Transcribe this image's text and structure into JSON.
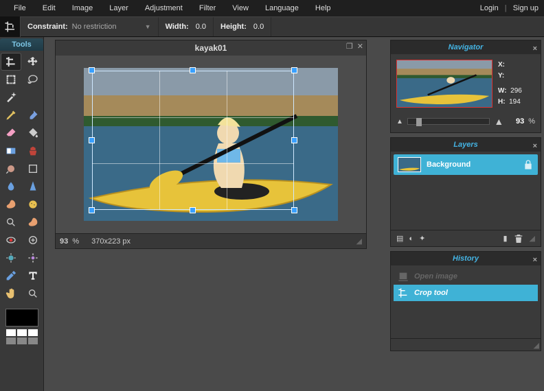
{
  "menu": {
    "items": [
      "File",
      "Edit",
      "Image",
      "Layer",
      "Adjustment",
      "Filter",
      "View",
      "Language",
      "Help"
    ],
    "login": "Login",
    "signup": "Sign up"
  },
  "options": {
    "constraint_label": "Constraint:",
    "constraint_value": "No restriction",
    "width_label": "Width:",
    "width_value": "0.0",
    "height_label": "Height:",
    "height_value": "0.0"
  },
  "tools": {
    "title": "Tools",
    "active_index": 0,
    "names": [
      "crop",
      "move",
      "marquee",
      "lasso",
      "wand",
      "",
      "pencil",
      "brush",
      "eraser",
      "paint-bucket",
      "gradient",
      "clone-stamp",
      "color-replace",
      "draw-shape",
      "blur",
      "sharpen",
      "smudge",
      "sponge",
      "dodge",
      "burn",
      "red-eye",
      "spot-heal",
      "bloat",
      "pinch",
      "color-picker",
      "type",
      "hand",
      "zoom"
    ]
  },
  "document": {
    "title": "kayak01",
    "zoom_status": "93",
    "zoom_pct": "%",
    "dimensions": "370x223 px"
  },
  "navigator": {
    "title": "Navigator",
    "x_label": "X:",
    "y_label": "Y:",
    "w_label": "W:",
    "h_label": "H:",
    "w_value": "296",
    "h_value": "194",
    "zoom_value": "93",
    "zoom_pct": "%"
  },
  "layers": {
    "title": "Layers",
    "items": [
      {
        "name": "Background",
        "locked": true
      }
    ]
  },
  "history": {
    "title": "History",
    "items": [
      {
        "label": "Open image",
        "active": false
      },
      {
        "label": "Crop tool",
        "active": true
      }
    ]
  }
}
